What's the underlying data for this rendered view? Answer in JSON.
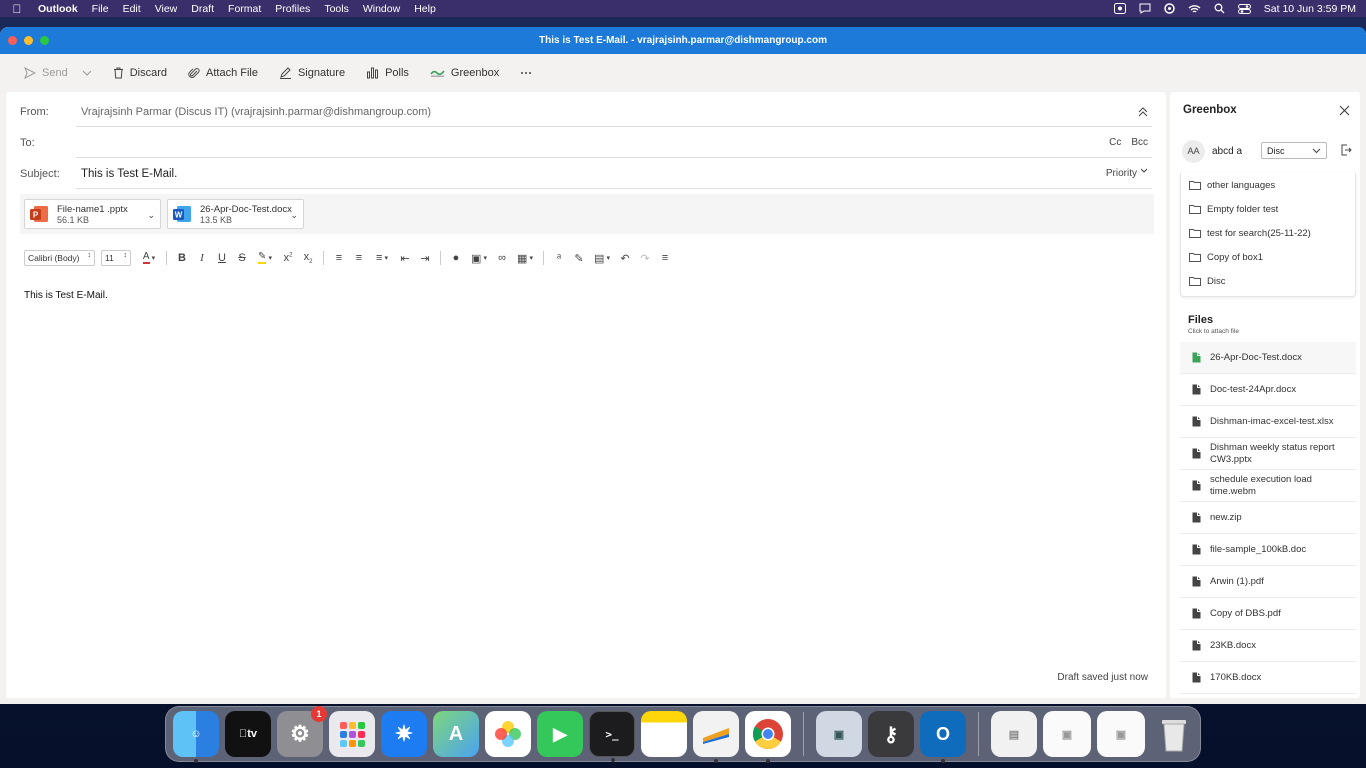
{
  "menubar": {
    "app": "Outlook",
    "items": [
      "File",
      "Edit",
      "View",
      "Draft",
      "Format",
      "Profiles",
      "Tools",
      "Window",
      "Help"
    ],
    "clock": "Sat 10 Jun  3:59 PM"
  },
  "window": {
    "title": "This is Test E-Mail. - vrajrajsinh.parmar@dishmangroup.com"
  },
  "toolbar": {
    "send": "Send",
    "discard": "Discard",
    "attach": "Attach File",
    "signature": "Signature",
    "polls": "Polls",
    "greenbox": "Greenbox"
  },
  "compose": {
    "from_label": "From:",
    "from_value": "Vrajrajsinh Parmar (Discus IT) (vrajrajsinh.parmar@dishmangroup.com)",
    "to_label": "To:",
    "cc": "Cc",
    "bcc": "Bcc",
    "subject_label": "Subject:",
    "subject_value": "This is Test E-Mail.",
    "priority": "Priority",
    "attachments": [
      {
        "name": "File-name1 .pptx",
        "size": "56.1 KB",
        "type": "pptx"
      },
      {
        "name": "26-Apr-Doc-Test.docx",
        "size": "13.5 KB",
        "type": "docx"
      }
    ],
    "font_name": "Calibri (Body)",
    "font_size": "11",
    "body": "This is Test E-Mail.",
    "draft_status": "Draft saved just now"
  },
  "panel": {
    "title": "Greenbox",
    "avatar": "AA",
    "user": "abcd a",
    "dropdown": "Disc",
    "folders": [
      "other languages",
      "Empty folder test",
      "test for search(25-11-22)",
      "Copy of box1",
      "Disc"
    ],
    "files_heading": "Files",
    "files_sub": "Click to attach file",
    "files": [
      "26-Apr-Doc-Test.docx",
      "Doc-test-24Apr.docx",
      "Dishman-imac-excel-test.xlsx",
      "Dishman weekly status report CW3.pptx",
      "schedule execution load time.webm",
      "new.zip",
      "file-sample_100kB.doc",
      "Arwin (1).pdf",
      "Copy of DBS.pdf",
      "23KB.docx",
      "170KB.docx"
    ]
  },
  "dock": {
    "settings_badge": "1",
    "tv_label": "tv"
  },
  "colors": {
    "titlebar": "#1d7ad9",
    "menubar": "#3a2f6b"
  }
}
